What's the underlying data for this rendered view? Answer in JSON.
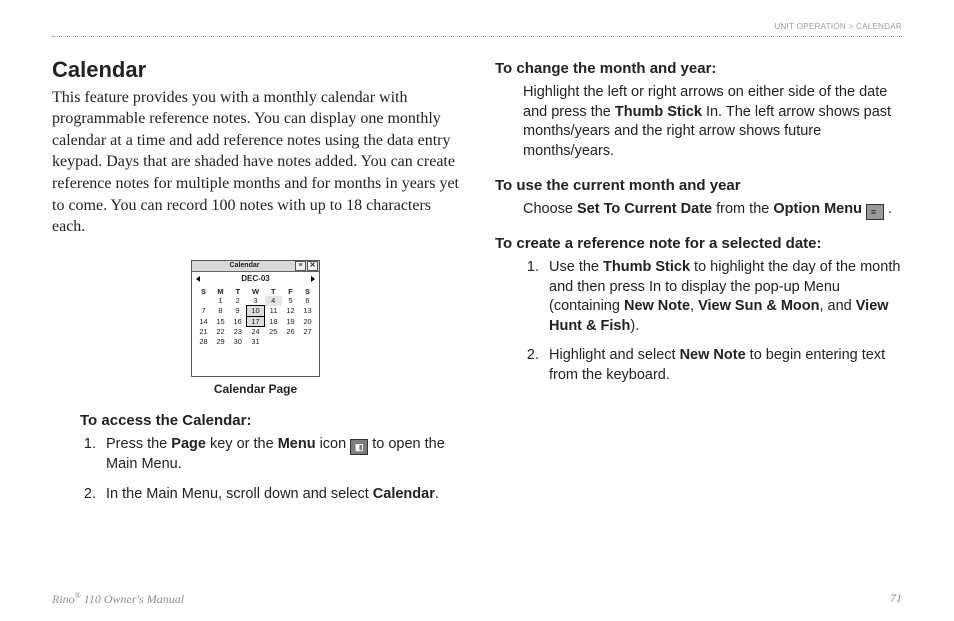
{
  "breadcrumb": {
    "section": "Unit Operation",
    "sep": " > ",
    "page": "Calendar"
  },
  "title": "Calendar",
  "intro": "This feature provides you with a monthly calendar with programmable reference notes. You can display one monthly calendar at a time and add reference notes using the data entry keypad. Days that are shaded have notes added. You can create reference notes for multiple months and for months in years yet to come. You can record 100 notes with up to 18 characters each.",
  "calendar_widget": {
    "title": "Calendar",
    "month_label": "DEC-03",
    "weekdays": [
      "S",
      "M",
      "T",
      "W",
      "T",
      "F",
      "S"
    ],
    "rows": [
      [
        "",
        "1",
        "2",
        "3",
        "4",
        "5",
        "6"
      ],
      [
        "7",
        "8",
        "9",
        "10",
        "11",
        "12",
        "13"
      ],
      [
        "14",
        "15",
        "16",
        "17",
        "18",
        "19",
        "20"
      ],
      [
        "21",
        "22",
        "23",
        "24",
        "25",
        "26",
        "27"
      ],
      [
        "28",
        "29",
        "30",
        "31",
        "",
        "",
        ""
      ]
    ],
    "note_cells": [
      "4"
    ],
    "cursor_cells": [
      "10",
      "17"
    ],
    "caption": "Calendar Page"
  },
  "left": {
    "access_heading": "To access the Calendar:",
    "access_steps": [
      {
        "pre": "Press the ",
        "b1": "Page",
        "mid": " key or the ",
        "b2": "Menu",
        "post_icon": " icon ",
        "tail": " to open the Main Menu."
      },
      {
        "pre": "In the Main Menu, scroll down and select ",
        "b1": "Calendar",
        "mid": ".",
        "b2": "",
        "post_icon": "",
        "tail": ""
      }
    ]
  },
  "right": {
    "change_heading": "To change the month and year:",
    "change_body": {
      "p1": "Highlight the left or right arrows on either side of the date and press the ",
      "b": "Thumb Stick",
      "p2": " In. The left arrow shows past months/years and the right arrow shows future months/years."
    },
    "current_heading": "To use the current month and year",
    "current_body": {
      "p1": "Choose ",
      "b1": "Set To Current Date",
      "p2": " from the ",
      "b2": "Option Menu",
      "p3": " ."
    },
    "create_heading": "To create a reference note for a selected date:",
    "create_steps": [
      {
        "p1": "Use the ",
        "b1": "Thumb Stick",
        "p2": " to highlight the day of the month and then press In to display the pop-up Menu (containing ",
        "b2": "New Note",
        "p3": ", ",
        "b3": "View Sun & Moon",
        "p4": ", and ",
        "b4": "View Hunt & Fish",
        "p5": ")."
      },
      {
        "p1": "Highlight and select ",
        "b1": "New Note",
        "p2": " to begin entering text from the keyboard.",
        "b2": "",
        "p3": "",
        "b3": "",
        "p4": "",
        "b4": "",
        "p5": ""
      }
    ]
  },
  "footer": {
    "left_pre": "Rino",
    "left_sup": "®",
    "left_post": " 110 Owner's Manual",
    "page_no": "71"
  },
  "icons": {
    "menu": "◧",
    "option": "≡"
  }
}
